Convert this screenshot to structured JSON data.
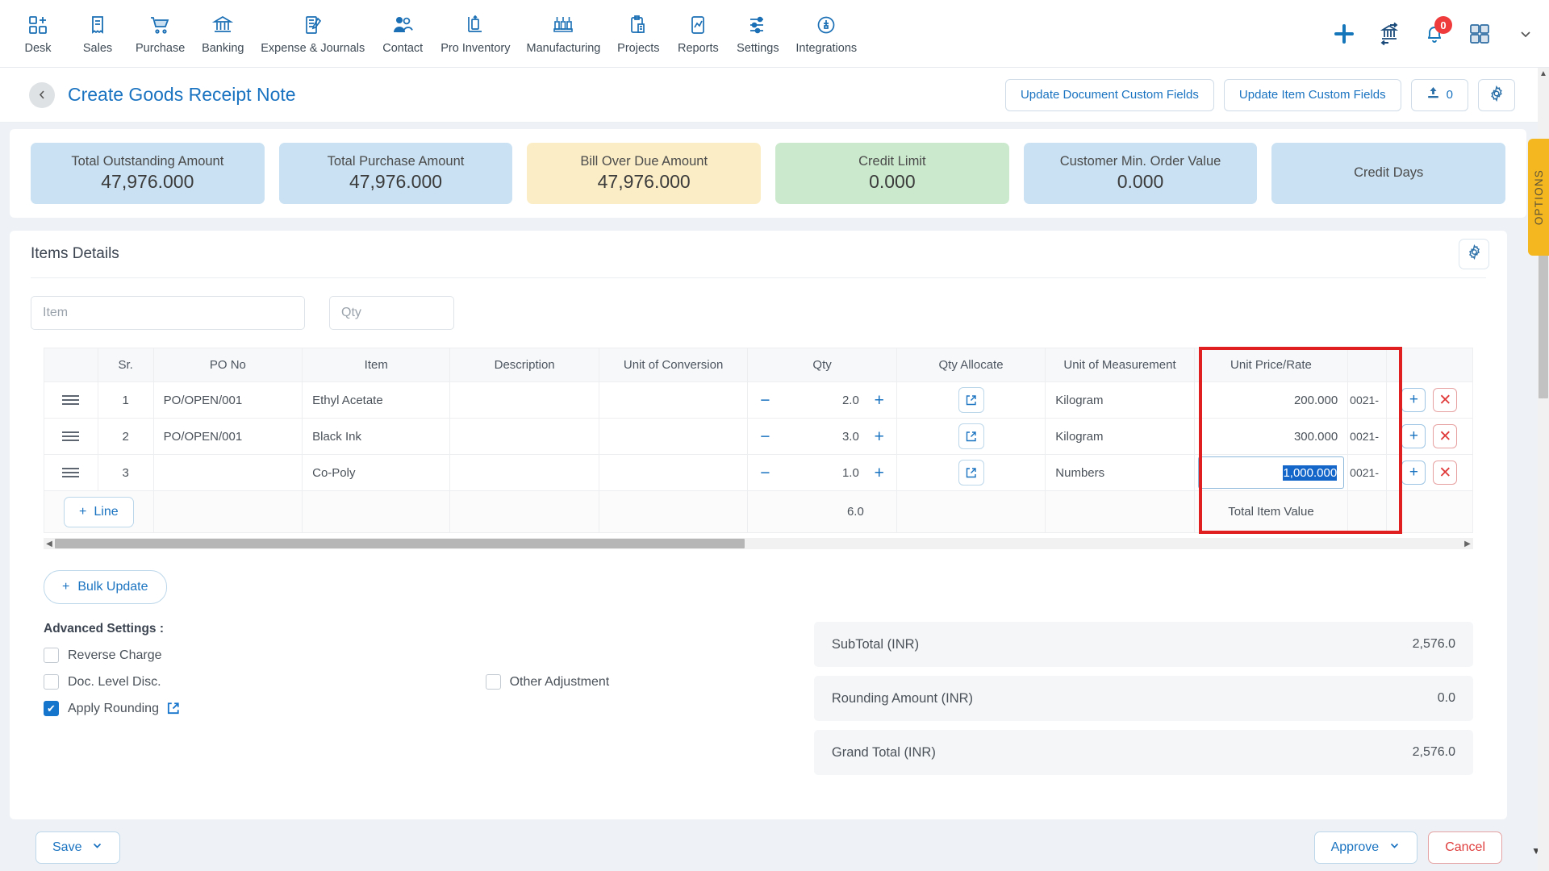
{
  "topnav": {
    "items": [
      {
        "label": "Desk",
        "icon": "desk-icon"
      },
      {
        "label": "Sales",
        "icon": "sales-receipt-icon"
      },
      {
        "label": "Purchase",
        "icon": "cart-icon"
      },
      {
        "label": "Banking",
        "icon": "bank-icon"
      },
      {
        "label": "Expense & Journals",
        "icon": "journal-icon"
      },
      {
        "label": "Contact",
        "icon": "people-icon"
      },
      {
        "label": "Pro Inventory",
        "icon": "inventory-icon"
      },
      {
        "label": "Manufacturing",
        "icon": "factory-icon"
      },
      {
        "label": "Projects",
        "icon": "clipboard-icon"
      },
      {
        "label": "Reports",
        "icon": "report-chart-icon"
      },
      {
        "label": "Settings",
        "icon": "sliders-icon"
      },
      {
        "label": "Integrations",
        "icon": "plug-icon"
      }
    ],
    "actions": {
      "add": "plus-icon",
      "bank_transfer": "bank-transfer-icon",
      "notifications": "bell-icon",
      "notification_count": "0",
      "apps": "grid-apps-icon",
      "collapse": "chevron-down-icon"
    }
  },
  "header": {
    "back": "chevron-left-icon",
    "title": "Create Goods Receipt Note",
    "update_document_custom_fields": "Update Document Custom Fields",
    "update_item_custom_fields": "Update Item Custom Fields",
    "attachment_icon": "upload-icon",
    "attachment_count": "0",
    "settings_icon": "gear-icon"
  },
  "summary_cards": [
    {
      "label": "Total Outstanding Amount",
      "value": "47,976.000",
      "color": "#c9e1f2"
    },
    {
      "label": "Total Purchase Amount",
      "value": "47,976.000",
      "color": "#c9e1f2"
    },
    {
      "label": "Bill Over Due Amount",
      "value": "47,976.000",
      "color": "#fbeec7"
    },
    {
      "label": "Credit Limit",
      "value": "0.000",
      "color": "#cbe9cd"
    },
    {
      "label": "Customer Min. Order Value",
      "value": "0.000",
      "color": "#c9e1f2"
    },
    {
      "label": "Credit Days",
      "value": "",
      "color": "#c9e1f2"
    }
  ],
  "options_tab": {
    "label": "OPTIONS",
    "color": "#f5b720"
  },
  "items_panel": {
    "title": "Items Details",
    "gear_icon": "gear-icon",
    "filters": {
      "item_placeholder": "Item",
      "qty_placeholder": "Qty"
    },
    "columns": [
      "",
      "Sr.",
      "PO No",
      "Item",
      "Description",
      "Unit of Conversion",
      "Qty",
      "Qty Allocate",
      "Unit of Measurement",
      "Unit Price/Rate",
      "",
      ""
    ],
    "rows": [
      {
        "sr": "1",
        "po_no": "PO/OPEN/001",
        "item": "Ethyl Acetate",
        "description": "",
        "unit_of_conversion": "",
        "qty": "2.0",
        "unit_of_measurement": "Kilogram",
        "unit_price": "200.000",
        "partial": "0021-",
        "selected": false
      },
      {
        "sr": "2",
        "po_no": "PO/OPEN/001",
        "item": "Black Ink",
        "description": "",
        "unit_of_conversion": "",
        "qty": "3.0",
        "unit_of_measurement": "Kilogram",
        "unit_price": "300.000",
        "partial": "0021-",
        "selected": false
      },
      {
        "sr": "3",
        "po_no": "",
        "item": "Co-Poly",
        "description": "",
        "unit_of_conversion": "",
        "qty": "1.0",
        "unit_of_measurement": "Numbers",
        "unit_price": "1,000.000",
        "partial": "0021-",
        "selected": true
      }
    ],
    "footer_row": {
      "add_line_label": "Line",
      "qty_total": "6.0",
      "total_item_value_label": "Total Item Value"
    },
    "highlight_color": "#e02020"
  },
  "bulk_update_label": "Bulk Update",
  "advanced_settings": {
    "title": "Advanced Settings :",
    "checkboxes": [
      {
        "label": "Reverse Charge",
        "checked": false
      },
      {
        "label": "Doc. Level Disc.",
        "checked": false
      },
      {
        "label": "Other Adjustment",
        "checked": false
      },
      {
        "label": "Apply Rounding",
        "checked": true,
        "has_external_link": true
      }
    ]
  },
  "totals": [
    {
      "label": "SubTotal (INR)",
      "value": "2,576.0"
    },
    {
      "label": "Rounding Amount (INR)",
      "value": "0.0"
    },
    {
      "label": "Grand Total (INR)",
      "value": "2,576.0"
    }
  ],
  "footer": {
    "save": "Save",
    "approve": "Approve",
    "cancel": "Cancel"
  }
}
